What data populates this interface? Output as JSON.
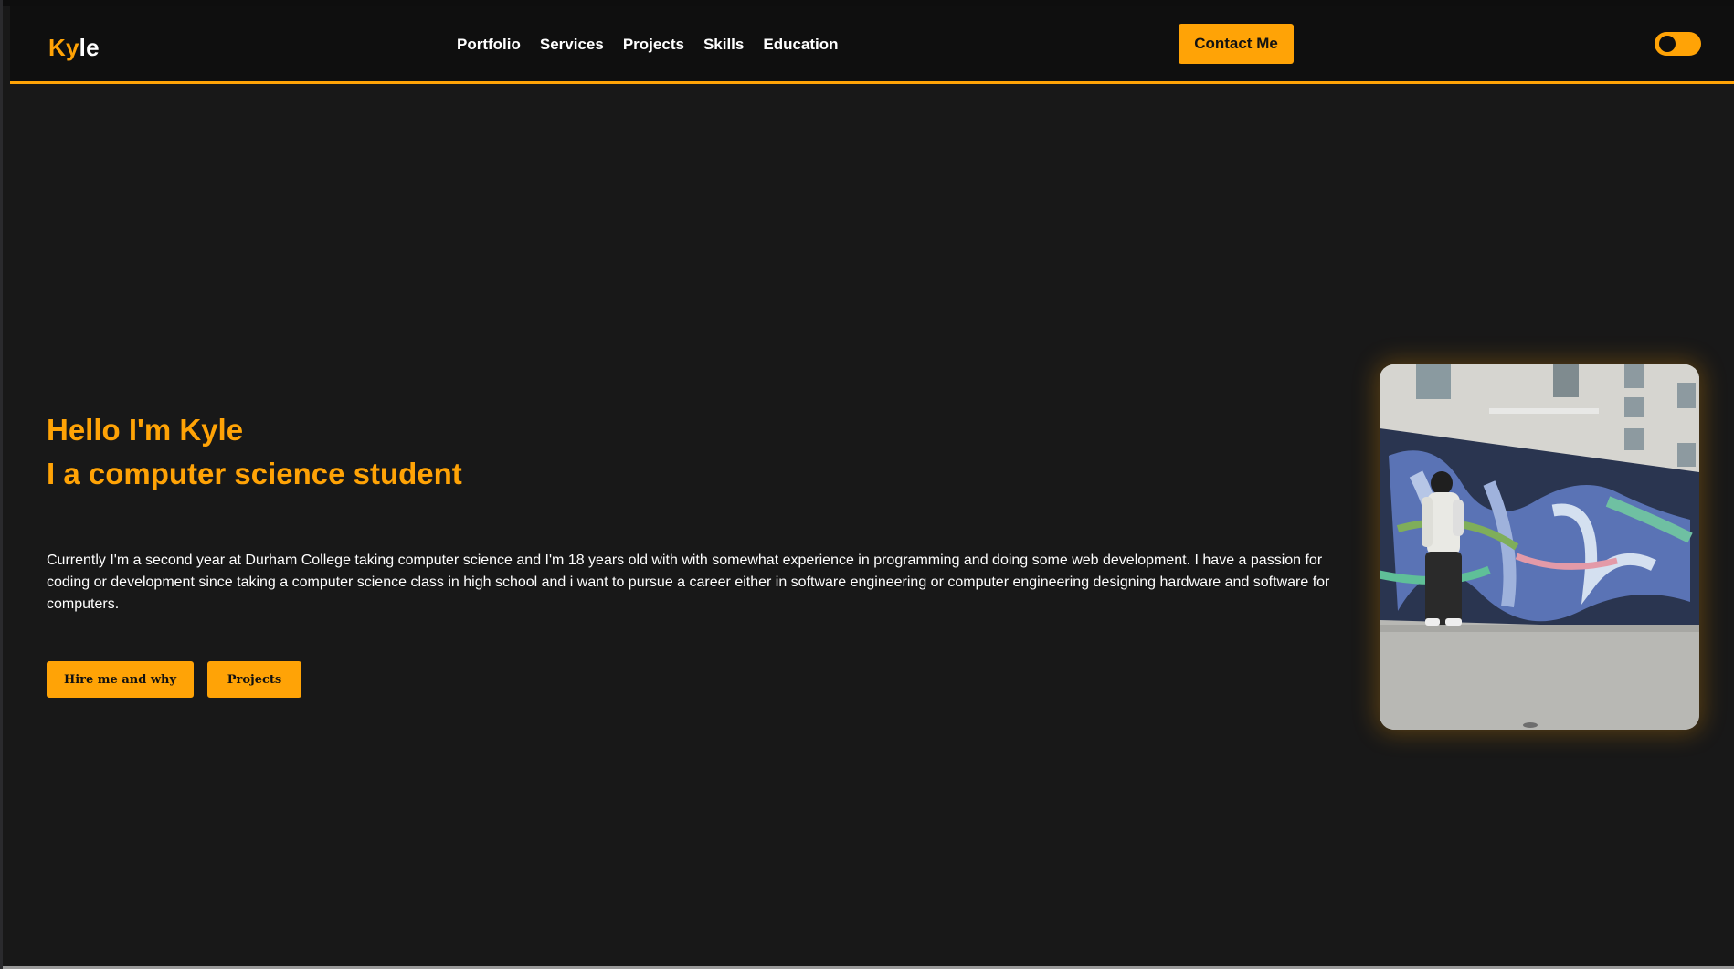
{
  "header": {
    "logo_accent": "Ky",
    "logo_rest": "le",
    "nav": [
      {
        "label": "Portfolio"
      },
      {
        "label": "Services"
      },
      {
        "label": "Projects"
      },
      {
        "label": "Skills"
      },
      {
        "label": "Education"
      }
    ],
    "contact_label": "Contact Me",
    "theme_toggle_icon": "toggle-switch-icon"
  },
  "hero": {
    "line1": "Hello I'm Kyle",
    "line2": "I a computer science student",
    "bio": "Currently I'm a second year at Durham College taking computer science and I'm 18 years old with with somewhat experience in programming and doing some web development. I have a passion for coding or development since taking a computer science class in high school and i want to pursue a career either in software engineering or computer engineering designing hardware and software for computers.",
    "buttons": {
      "hire": "Hire me and why",
      "projects": "Projects"
    }
  },
  "colors": {
    "accent": "#ffa306",
    "background": "#181818",
    "header_bg": "#0f0f0f",
    "text": "#ffffff"
  }
}
